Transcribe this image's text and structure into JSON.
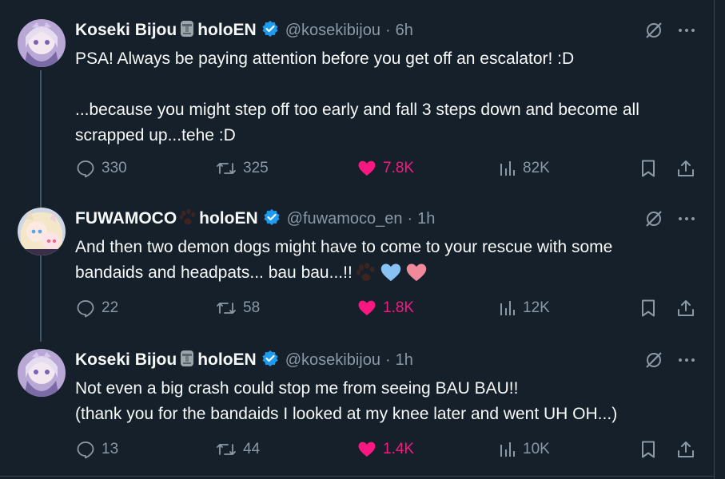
{
  "tweets": [
    {
      "display_name": "Koseki Bijou",
      "emoji": "moai-icon",
      "affiliation": "holoEN",
      "handle": "@kosekibijou",
      "separator": "·",
      "time": "6h",
      "text_lines": [
        "PSA! Always be paying attention before you get off an escalator! :D",
        "",
        "...because you might step off too early and fall 3 steps down and become all",
        "scrapped up...tehe :D"
      ],
      "replies": "330",
      "reposts": "325",
      "likes": "7.8K",
      "views": "82K"
    },
    {
      "display_name": "FUWAMOCO",
      "emoji": "paw-icon",
      "affiliation": "holoEN",
      "handle": "@fuwamoco_en",
      "separator": "·",
      "time": "1h",
      "text_lines": [
        "And then two demon dogs might have to come to your rescue with some",
        "bandaids and headpats... bau bau...!!"
      ],
      "trailing_emojis": [
        "paw-icon",
        "blue-heart-icon",
        "pink-heart-icon"
      ],
      "replies": "22",
      "reposts": "58",
      "likes": "1.8K",
      "views": "12K"
    },
    {
      "display_name": "Koseki Bijou",
      "emoji": "moai-icon",
      "affiliation": "holoEN",
      "handle": "@kosekibijou",
      "separator": "·",
      "time": "1h",
      "text_lines": [
        "Not even a big crash could stop me from seeing BAU BAU!!",
        "(thank you for the bandaids I looked at my knee later and went UH OH...)"
      ],
      "replies": "13",
      "reposts": "44",
      "likes": "1.4K",
      "views": "10K"
    }
  ],
  "colors": {
    "background": "#15202b",
    "text": "#f7f9f9",
    "muted": "#8b98a5",
    "verified": "#1d9bf0",
    "like": "#f91880",
    "thread_line": "#425364"
  }
}
